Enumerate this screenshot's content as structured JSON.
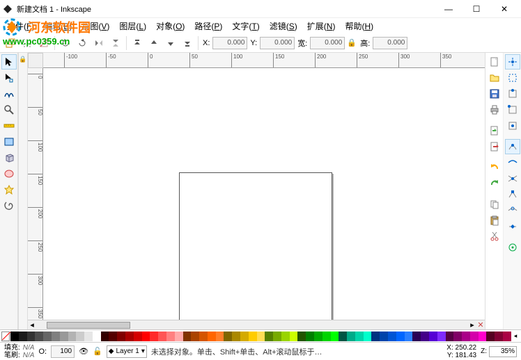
{
  "title": "新建文档 1 - Inkscape",
  "menus": [
    {
      "label": "文件",
      "key": "F"
    },
    {
      "label": "编辑",
      "key": "E"
    },
    {
      "label": "视图",
      "key": "V"
    },
    {
      "label": "图层",
      "key": "L"
    },
    {
      "label": "对象",
      "key": "O"
    },
    {
      "label": "路径",
      "key": "P"
    },
    {
      "label": "文字",
      "key": "T"
    },
    {
      "label": "滤镜",
      "key": "S"
    },
    {
      "label": "扩展",
      "key": "N"
    },
    {
      "label": "帮助",
      "key": "H"
    }
  ],
  "watermark": {
    "cn": "河东软件园",
    "url": "www.pc0359.cn"
  },
  "toolbar": {
    "x_label": "X:",
    "x_val": "0.000",
    "y_label": "Y:",
    "y_val": "0.000",
    "w_label": "宽:",
    "w_val": "0.000",
    "h_label": "高:",
    "h_val": "0.000"
  },
  "ruler_h": [
    -100,
    -50,
    0,
    50,
    100,
    150,
    200,
    250,
    300,
    350
  ],
  "ruler_v": [
    0,
    50,
    100,
    150,
    200,
    250,
    300,
    350
  ],
  "palette": [
    "#000000",
    "#1a1a1a",
    "#333333",
    "#4d4d4d",
    "#666666",
    "#808080",
    "#999999",
    "#b3b3b3",
    "#cccccc",
    "#e6e6e6",
    "#ffffff",
    "#330000",
    "#550000",
    "#800000",
    "#aa0000",
    "#d40000",
    "#ff0000",
    "#ff2a2a",
    "#ff5555",
    "#ff8080",
    "#ffaaaa",
    "#803300",
    "#aa4400",
    "#d45500",
    "#ff6600",
    "#ff7f2a",
    "#806600",
    "#aa8800",
    "#d4aa00",
    "#ffcc00",
    "#ffdd55",
    "#558000",
    "#77aa00",
    "#99d400",
    "#ccff00",
    "#225500",
    "#008000",
    "#00aa00",
    "#00d400",
    "#00ff00",
    "#005544",
    "#00aa88",
    "#00d4aa",
    "#00ffcc",
    "#003380",
    "#0044aa",
    "#0055d4",
    "#0066ff",
    "#2a7fff",
    "#2b0055",
    "#440088",
    "#5500d4",
    "#7f2aff",
    "#550044",
    "#800066",
    "#aa0088",
    "#d400aa",
    "#ff00cc",
    "#550022",
    "#800033",
    "#aa0044"
  ],
  "status": {
    "fill_label": "填充:",
    "fill_val": "N/A",
    "stroke_label": "笔刷:",
    "stroke_val": "N/A",
    "opacity_label": "O:",
    "opacity_val": "100",
    "layer": "Layer 1",
    "msg": "未选择对象。单击、Shift+单击、Alt+滚动鼠标于…",
    "x_label": "X:",
    "x_val": "250.22",
    "y_label": "Y:",
    "y_val": "181.43",
    "z_label": "Z:",
    "zoom": "35%"
  }
}
